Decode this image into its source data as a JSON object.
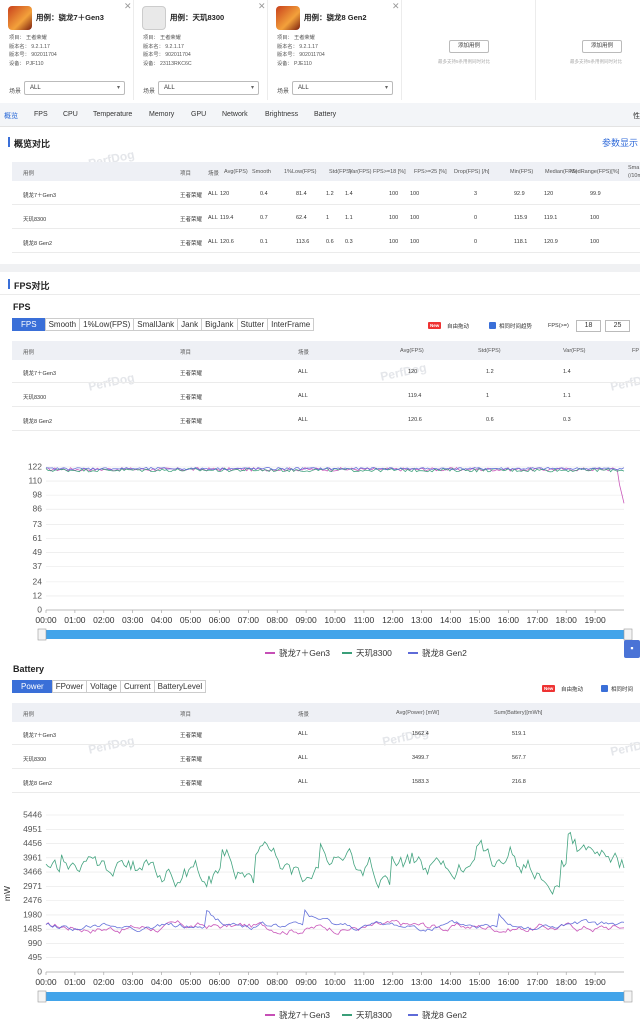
{
  "cases": [
    {
      "title": "用例：骁龙7＋Gen3",
      "project": "项目： 王者荣耀",
      "version_name": "版本名： 9.2.1.17",
      "version_no": "版本号： 902011704",
      "device": "设备： PJF110",
      "scene_label": "场景",
      "scene_value": "ALL"
    },
    {
      "title": "用例：天玑8300",
      "project": "项目： 王者荣耀",
      "version_name": "版本名： 9.2.1.17",
      "version_no": "版本号： 902011704",
      "device": "设备： 23113RKC6C",
      "scene_label": "场景",
      "scene_value": "ALL"
    },
    {
      "title": "用例：骁龙8 Gen2",
      "project": "项目： 王者荣耀",
      "version_name": "版本名： 9.2.1.17",
      "version_no": "版本号： 902011704",
      "device": "设备： PJE110",
      "scene_label": "场景",
      "scene_value": "ALL"
    }
  ],
  "add_slots": [
    {
      "button": "添加用例",
      "hint": "最多支持5条用例同时对比"
    },
    {
      "button": "添加用例",
      "hint": "最多支持5条用例同时对比"
    }
  ],
  "tabs": [
    "概览",
    "FPS",
    "CPU",
    "Temperature",
    "Memory",
    "GPU",
    "Network",
    "Brightness",
    "Battery"
  ],
  "tabs_more": "性",
  "overview": {
    "title": "概览对比",
    "params_link": "参数显示",
    "headers": [
      "用例",
      "项目",
      "场景",
      "Avg(FPS)",
      "Smooth",
      "1%Low(FPS)",
      "Std(FPS)",
      "Var(FPS)",
      "FPS>=18 [%]",
      "FPS>=25 [%]",
      "Drop(FPS) [/h]",
      "Min(FPS)",
      "Median(FPS)",
      "MedRange(FPS)[%]",
      "Sma",
      "(/10m"
    ],
    "rows": [
      [
        "骁龙7＋Gen3",
        "王者荣耀",
        "ALL",
        "120",
        "0.4",
        "81.4",
        "1.2",
        "1.4",
        "100",
        "100",
        "3",
        "92.9",
        "120",
        "99.9"
      ],
      [
        "天玑8300",
        "王者荣耀",
        "ALL",
        "119.4",
        "0.7",
        "62.4",
        "1",
        "1.1",
        "100",
        "100",
        "0",
        "115.9",
        "119.1",
        "100"
      ],
      [
        "骁龙8 Gen2",
        "王者荣耀",
        "ALL",
        "120.6",
        "0.1",
        "113.6",
        "0.6",
        "0.3",
        "100",
        "100",
        "0",
        "118.1",
        "120.9",
        "100"
      ]
    ]
  },
  "fps_section": {
    "title": "FPS对比",
    "subtitle": "FPS",
    "subtabs": [
      "FPS",
      "Smooth",
      "1%Low(FPS)",
      "SmallJank",
      "Jank",
      "BigJank",
      "Stutter",
      "InterFrame"
    ],
    "new_badge": "New",
    "free_drag": "自由拖动",
    "same_time": "相同时间趋势",
    "fps_ge": "FPS(>=)",
    "fps_threshold_1": "18",
    "fps_threshold_2": "25",
    "headers": [
      "用例",
      "项目",
      "场景",
      "Avg(FPS)",
      "Std(FPS)",
      "Var(FPS)",
      "FP"
    ],
    "rows": [
      [
        "骁龙7＋Gen3",
        "王者荣耀",
        "ALL",
        "120",
        "1.2",
        "1.4"
      ],
      [
        "天玑8300",
        "王者荣耀",
        "ALL",
        "119.4",
        "1",
        "1.1"
      ],
      [
        "骁龙8 Gen2",
        "王者荣耀",
        "ALL",
        "120.6",
        "0.6",
        "0.3"
      ]
    ]
  },
  "battery_section": {
    "title": "Battery",
    "subtabs": [
      "Power",
      "FPower",
      "Voltage",
      "Current",
      "BatteryLevel"
    ],
    "new_badge": "New",
    "free_drag": "自由拖动",
    "same_time": "相同时间",
    "headers": [
      "用例",
      "项目",
      "场景",
      "Avg(Power) [mW]",
      "Sum(Battery)[mWh]"
    ],
    "rows": [
      [
        "骁龙7＋Gen3",
        "王者荣耀",
        "ALL",
        "1562.4",
        "519.1"
      ],
      [
        "天玑8300",
        "王者荣耀",
        "ALL",
        "3499.7",
        "567.7"
      ],
      [
        "骁龙8 Gen2",
        "王者荣耀",
        "ALL",
        "1583.3",
        "216.8"
      ]
    ]
  },
  "watermark": "PerfDog",
  "colors": {
    "accent": "#3a6fd8",
    "series1": "#c64fb6",
    "series2": "#3a9f79",
    "series3": "#5e6bd8",
    "slider": "#42a4ea"
  },
  "chart_data": [
    {
      "type": "line",
      "title": "",
      "xlabel": "",
      "ylabel": "",
      "x": [
        "00:00",
        "01:00",
        "02:00",
        "03:00",
        "04:00",
        "05:00",
        "06:00",
        "07:00",
        "08:00",
        "09:00",
        "10:00",
        "11:00",
        "12:00",
        "13:00",
        "14:00",
        "15:00",
        "16:00",
        "17:00",
        "18:00",
        "19:00"
      ],
      "y_ticks": [
        122,
        110,
        98,
        86,
        73,
        61,
        49,
        37,
        24,
        12,
        0
      ],
      "ylim": [
        0,
        122
      ],
      "grid": true,
      "legend": "bottom",
      "series": [
        {
          "name": "骁龙7＋Gen3",
          "mean": 120,
          "note_end_dip": 91
        },
        {
          "name": "天玑8300",
          "mean": 119.4
        },
        {
          "name": "骁龙8 Gen2",
          "mean": 120.6
        }
      ]
    },
    {
      "type": "line",
      "title": "",
      "xlabel": "",
      "ylabel": "mW",
      "x": [
        "00:00",
        "01:00",
        "02:00",
        "03:00",
        "04:00",
        "05:00",
        "06:00",
        "07:00",
        "08:00",
        "09:00",
        "10:00",
        "11:00",
        "12:00",
        "13:00",
        "14:00",
        "15:00",
        "16:00",
        "17:00",
        "18:00",
        "19:00"
      ],
      "y_ticks": [
        5446,
        4951,
        4456,
        3961,
        3466,
        2971,
        2476,
        1980,
        1485,
        990,
        495,
        0
      ],
      "ylim": [
        0,
        5446
      ],
      "grid": true,
      "legend": "bottom",
      "series": [
        {
          "name": "骁龙7＋Gen3",
          "mean": 1562.4
        },
        {
          "name": "天玑8300",
          "mean": 3499.7
        },
        {
          "name": "骁龙8 Gen2",
          "mean": 1583.3
        }
      ]
    }
  ]
}
